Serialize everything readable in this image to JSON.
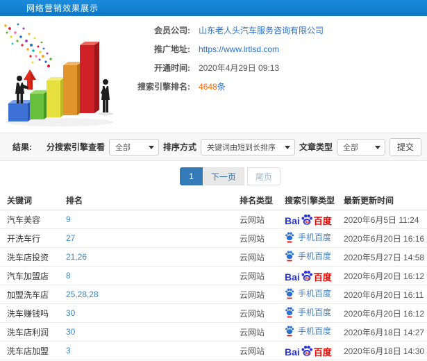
{
  "colors": {
    "accent": "#1484d6",
    "link": "#2a6fc9",
    "orange": "#ff6600",
    "bdblue": "#2632dc",
    "bdred": "#e10602",
    "mobileblue": "#4a82c4",
    "pgactive": "#337ab7"
  },
  "header": {
    "title": "网络营销效果展示"
  },
  "info": {
    "rows": [
      {
        "label": "会员公司:",
        "value": "山东老人头汽车服务咨询有限公司"
      },
      {
        "label": "推广地址:",
        "value": "https://www.lrtlsd.com"
      },
      {
        "label": "开通时间:",
        "value": "2020年4月29日 09:13"
      },
      {
        "label": "搜索引擎排名:",
        "value": "4648",
        "suffix": "条"
      }
    ]
  },
  "filters": {
    "result_label": "结果:",
    "engine_label": "分搜索引擎查看",
    "engine_value": "全部",
    "sort_label": "排序方式",
    "sort_value": "关键词由短到长排序",
    "article_label": "文章类型",
    "article_value": "全部",
    "submit_label": "提交"
  },
  "pagination": {
    "current": "1",
    "next": "下一页",
    "last": "尾页"
  },
  "table": {
    "headers": [
      "关键词",
      "排名",
      "排名类型",
      "搜索引擎类型",
      "最新更新时间"
    ],
    "engine_labels": {
      "bai": "Bai",
      "du": "du",
      "cn": "百度",
      "mobile": "手机百度"
    },
    "rows": [
      {
        "keyword": "汽车美容",
        "rank": "9",
        "rank_type": "云网站",
        "engine": "baidu",
        "time": "2020年6月5日 11:24"
      },
      {
        "keyword": "开洗车行",
        "rank": "27",
        "rank_type": "云网站",
        "engine": "mobile-baidu",
        "time": "2020年6月20日 16:16"
      },
      {
        "keyword": "洗车店投资",
        "rank": "21,26",
        "rank_type": "云网站",
        "engine": "mobile-baidu",
        "time": "2020年5月27日 14:58"
      },
      {
        "keyword": "汽车加盟店",
        "rank": "8",
        "rank_type": "云网站",
        "engine": "baidu",
        "time": "2020年6月20日 16:12"
      },
      {
        "keyword": "加盟洗车店",
        "rank": "25,28,28",
        "rank_type": "云网站",
        "engine": "mobile-baidu",
        "time": "2020年6月20日 16:11"
      },
      {
        "keyword": "洗车赚钱吗",
        "rank": "30",
        "rank_type": "云网站",
        "engine": "mobile-baidu",
        "time": "2020年6月20日 16:12"
      },
      {
        "keyword": "洗车店利润",
        "rank": "30",
        "rank_type": "云网站",
        "engine": "mobile-baidu",
        "time": "2020年6月18日 14:27"
      },
      {
        "keyword": "洗车店加盟",
        "rank": "3",
        "rank_type": "云网站",
        "engine": "baidu",
        "time": "2020年6月18日 14:30"
      }
    ]
  }
}
